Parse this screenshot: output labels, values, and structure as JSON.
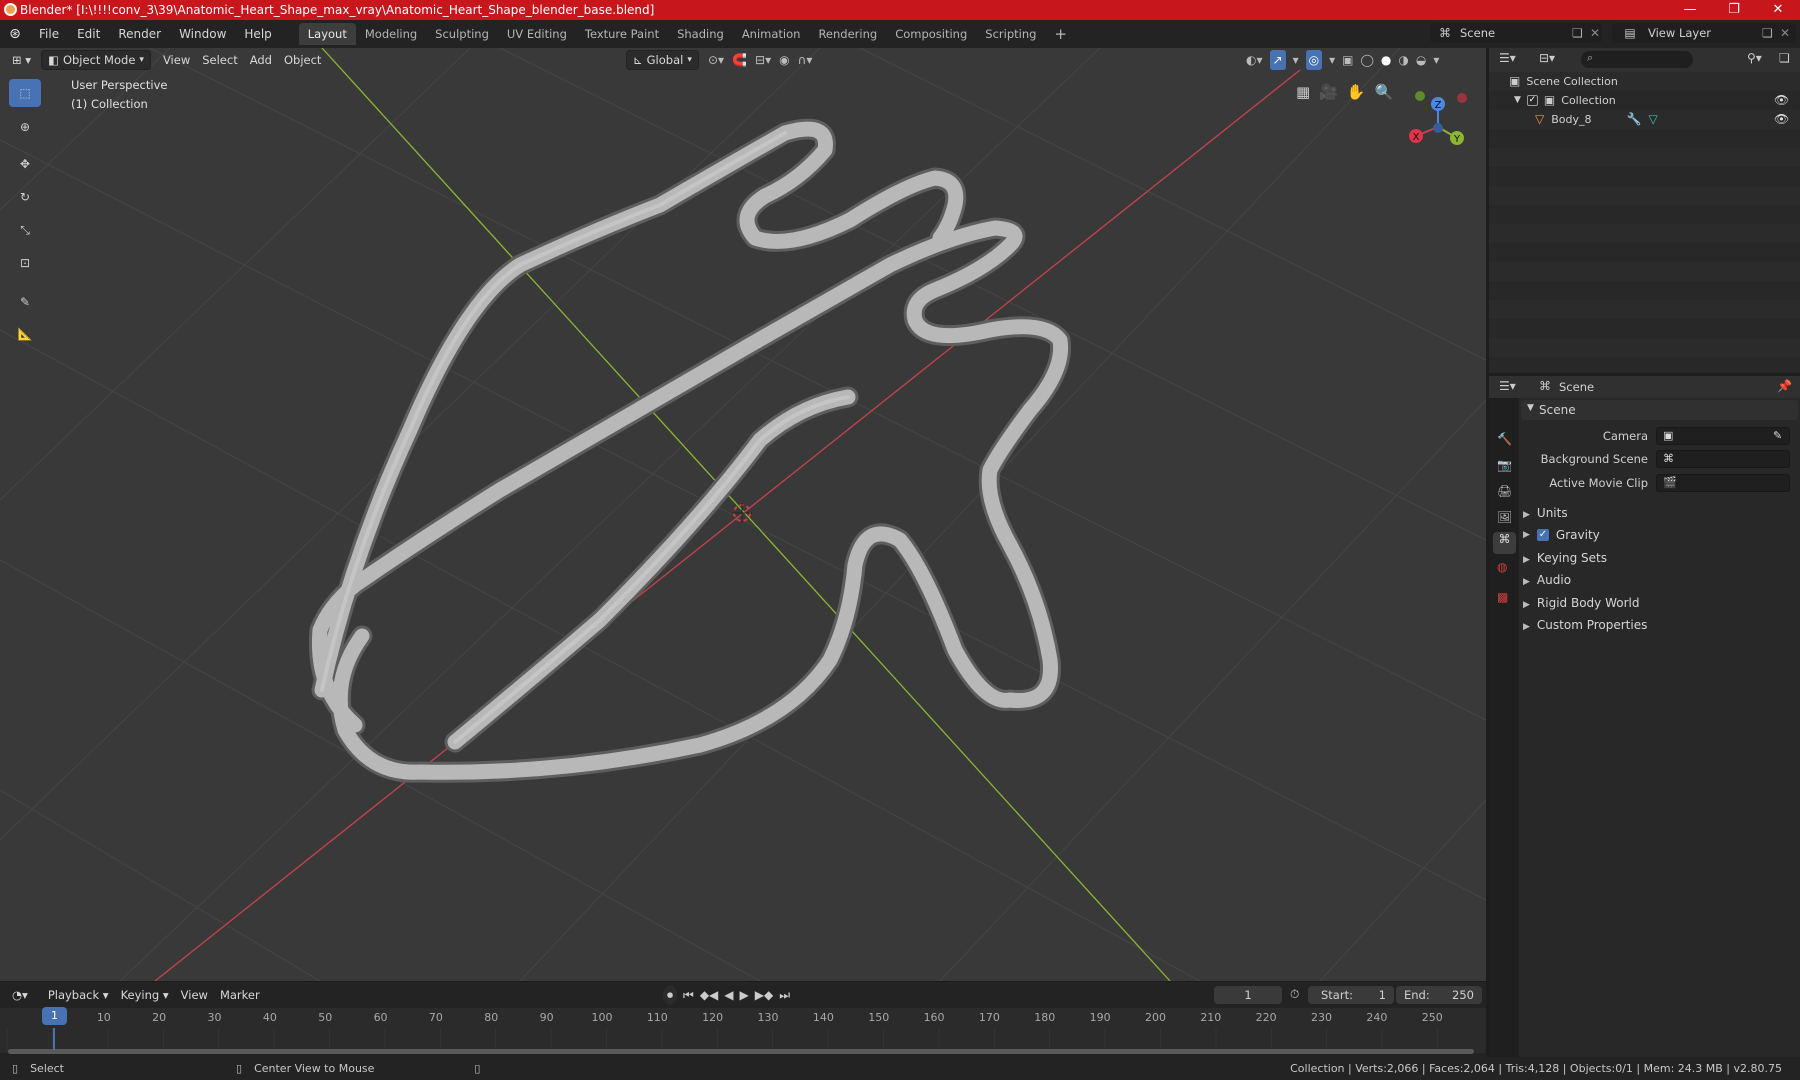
{
  "window": {
    "title": "Blender* [I:\\!!!!conv_3\\39\\Anatomic_Heart_Shape_max_vray\\Anatomic_Heart_Shape_blender_base.blend]",
    "minimize": "—",
    "maximize": "❐",
    "close": "✕"
  },
  "menubar": {
    "menus": [
      "File",
      "Edit",
      "Render",
      "Window",
      "Help"
    ],
    "workspaces": [
      "Layout",
      "Modeling",
      "Sculpting",
      "UV Editing",
      "Texture Paint",
      "Shading",
      "Animation",
      "Rendering",
      "Compositing",
      "Scripting"
    ],
    "active_workspace": "Layout",
    "add_workspace": "+",
    "scene": "Scene",
    "view_layer": "View Layer"
  },
  "viewport_header": {
    "mode": "Object Mode",
    "menus": [
      "View",
      "Select",
      "Add",
      "Object"
    ],
    "orientation": "Global"
  },
  "viewport": {
    "perspective": "User Perspective",
    "collection": "(1) Collection",
    "gizmo_axes": [
      "X",
      "Y",
      "Z"
    ],
    "colors": {
      "x_axis": "#c8424e",
      "y_axis": "#8db432",
      "z_axis": "#4c88e0",
      "tube": "#b8b8b8",
      "background": "#393939"
    }
  },
  "toolbar": {
    "tools": [
      "select-box-icon",
      "cursor-icon",
      "move-icon",
      "rotate-icon",
      "scale-icon",
      "transform-icon",
      "annotate-icon",
      "measure-icon"
    ]
  },
  "outliner": {
    "root": "Scene Collection",
    "collection": "Collection",
    "object": "Body_8"
  },
  "properties": {
    "header": "Scene",
    "panel_title": "Scene",
    "camera_label": "Camera",
    "background_scene_label": "Background Scene",
    "active_movie_clip_label": "Active Movie Clip",
    "sections": [
      "Units",
      "Gravity",
      "Keying Sets",
      "Audio",
      "Rigid Body World",
      "Custom Properties"
    ],
    "gravity_checked": true
  },
  "timeline": {
    "menus": [
      "Playback",
      "Keying",
      "View",
      "Marker"
    ],
    "current_frame": "1",
    "start_label": "Start:",
    "start": "1",
    "end_label": "End:",
    "end": "250",
    "ticks": [
      "1",
      "10",
      "20",
      "30",
      "40",
      "50",
      "60",
      "70",
      "80",
      "90",
      "100",
      "110",
      "120",
      "130",
      "140",
      "150",
      "160",
      "170",
      "180",
      "190",
      "200",
      "210",
      "220",
      "230",
      "240",
      "250"
    ]
  },
  "statusbar": {
    "select": "Select",
    "center_view": "Center View to Mouse",
    "stats": "Collection | Verts:2,066 | Faces:2,064 | Tris:4,128 | Objects:0/1 | Mem: 24.3 MB | v2.80.75"
  }
}
